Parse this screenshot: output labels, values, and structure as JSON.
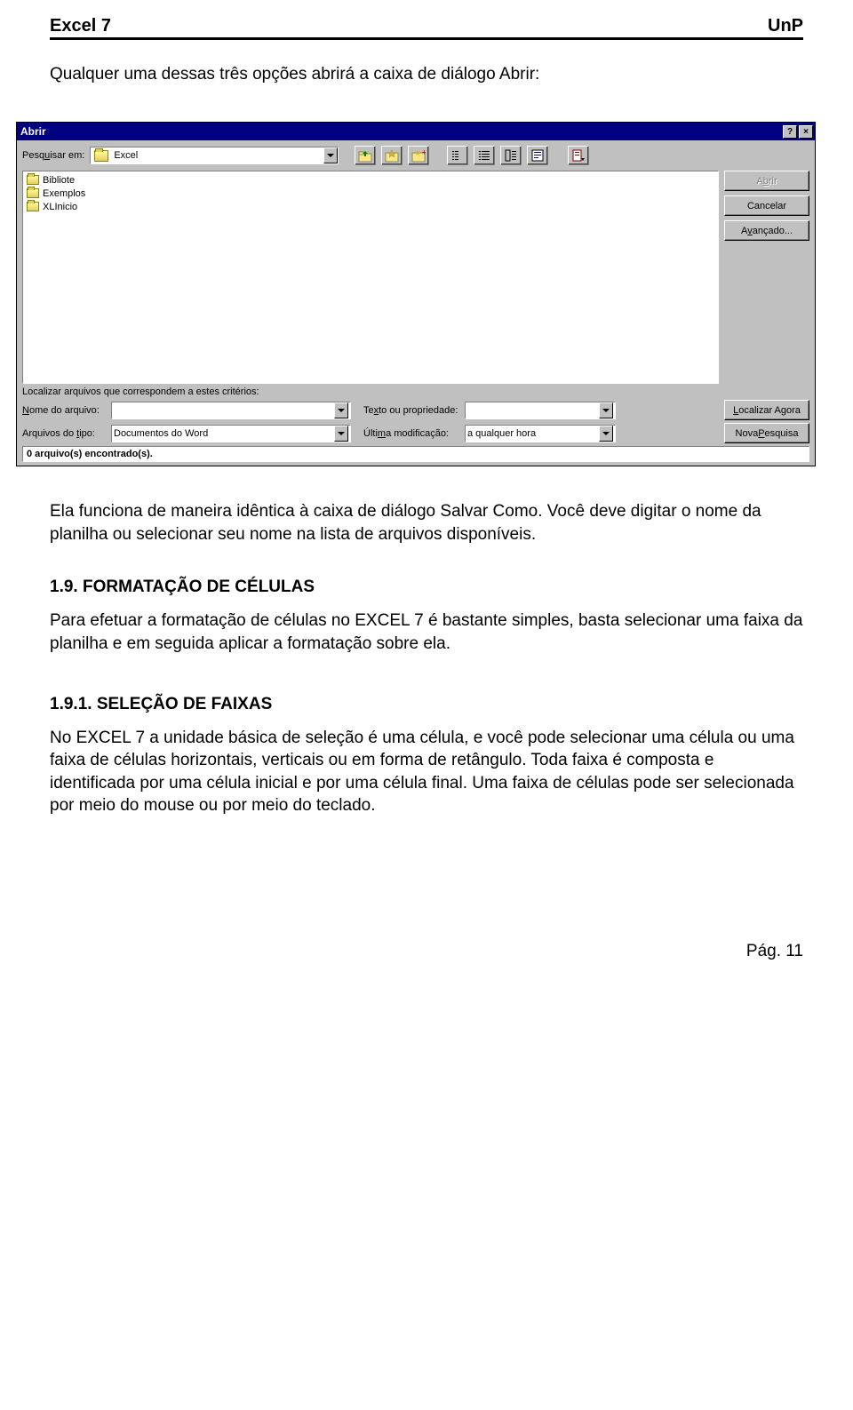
{
  "header": {
    "left": "Excel 7",
    "right": "UnP"
  },
  "intro": "Qualquer uma dessas três opções abrirá a caixa de diálogo Abrir:",
  "dialog": {
    "title": "Abrir",
    "help_btn": "?",
    "close_btn": "×",
    "pesquisar_label_pre": "Pesq",
    "pesquisar_label_u": "u",
    "pesquisar_label_post": "isar em:",
    "folder_name": "Excel",
    "file_items": [
      "Bibliote",
      "Exemplos",
      "XLInicio"
    ],
    "buttons": {
      "abrir_pre": "A",
      "abrir_u": "b",
      "abrir_post": "rir",
      "cancelar": "Cancelar",
      "avanc_pre": "A",
      "avanc_u": "v",
      "avanc_post": "ançado...",
      "loc_pre": "",
      "loc_u": "L",
      "loc_post": "ocalizar Agora",
      "nova_pre": "Nova ",
      "nova_u": "P",
      "nova_post": "esquisa"
    },
    "criteria_label": "Localizar arquivos que correspondem a estes critérios:",
    "nome_pre": "",
    "nome_u": "N",
    "nome_post": "ome do arquivo:",
    "tipo_pre": "Arquivos do ",
    "tipo_u": "t",
    "tipo_post": "ipo:",
    "tipo_value": "Documentos do Word",
    "texto_pre": "Te",
    "texto_u": "x",
    "texto_post": "to ou propriedade:",
    "ultima_pre": "Últi",
    "ultima_u": "m",
    "ultima_post": "a modificação:",
    "ultima_value": "a qualquer hora",
    "status": "0 arquivo(s) encontrado(s)."
  },
  "body1": "Ela funciona de maneira idêntica à caixa de diálogo Salvar Como. Você deve digitar o nome da planilha ou selecionar seu nome na lista de arquivos disponíveis.",
  "sec19": "1.9.   FORMATAÇÃO DE CÉLULAS",
  "body2": "Para efetuar a formatação de células no EXCEL 7 é bastante simples, basta selecionar uma faixa da planilha e em seguida aplicar a formatação sobre ela.",
  "sec191": "1.9.1. SELEÇÃO DE FAIXAS",
  "body3": "No EXCEL 7 a unidade básica de seleção é uma célula, e você pode selecionar uma célula ou uma faixa de células horizontais, verticais ou em forma de retângulo. Toda faixa é composta e identificada por uma célula inicial e por uma célula final. Uma faixa de células pode ser selecionada por meio do mouse ou por meio do teclado.",
  "footer": "Pág. 11"
}
